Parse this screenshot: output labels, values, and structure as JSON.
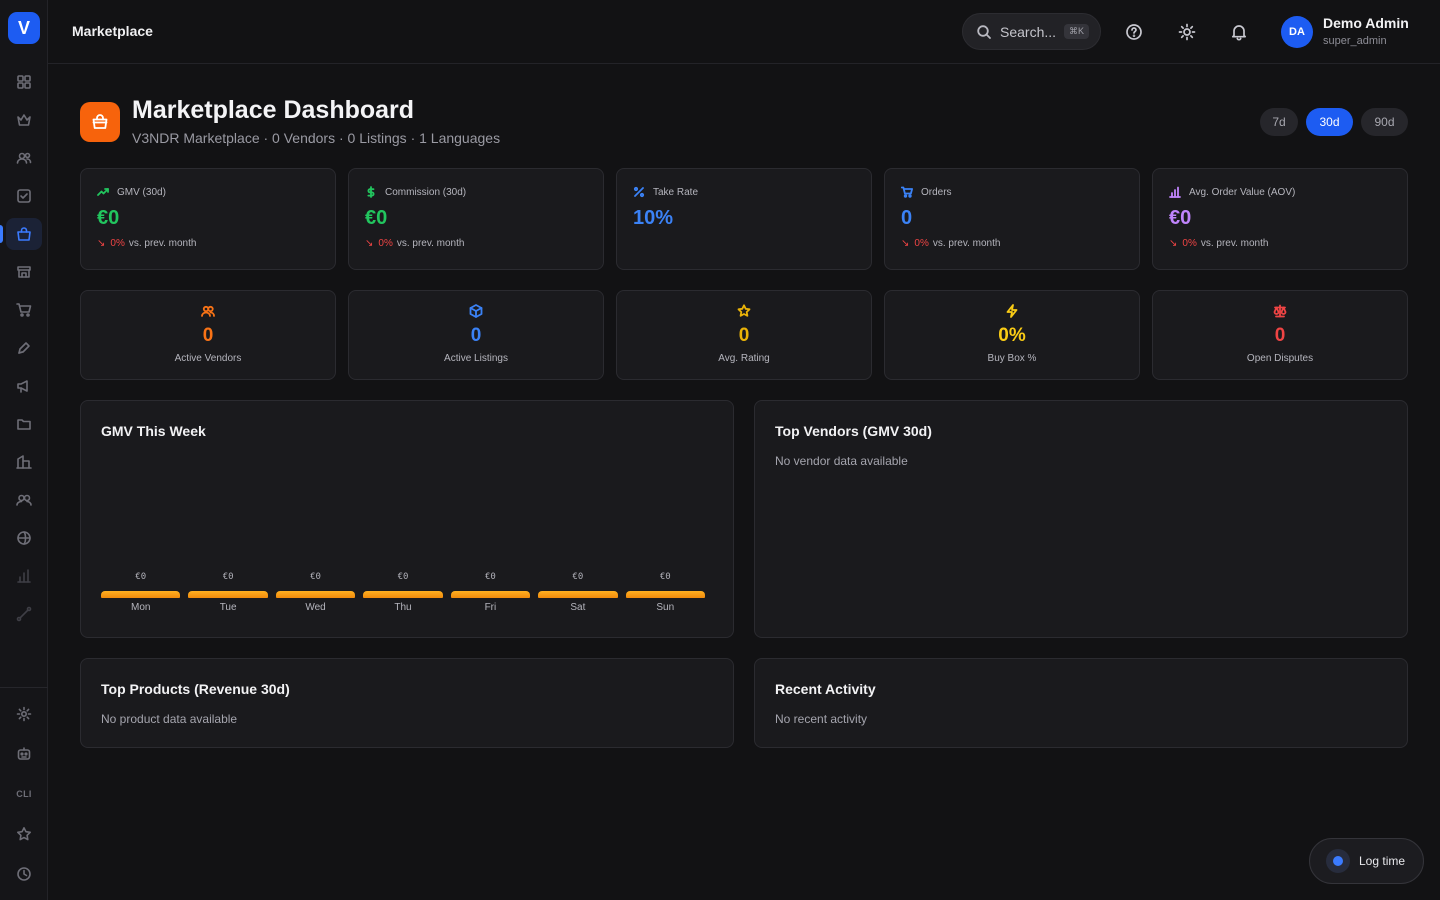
{
  "app": {
    "logo_letter": "V"
  },
  "topbar": {
    "title": "Marketplace",
    "search_placeholder": "Search...",
    "search_shortcut": "⌘K",
    "user": {
      "initials": "DA",
      "name": "Demo Admin",
      "role": "super_admin"
    }
  },
  "sidebar": {
    "items": [
      {
        "icon": "grid-icon"
      },
      {
        "icon": "crown-icon"
      },
      {
        "icon": "users-icon"
      },
      {
        "icon": "check-square-icon"
      },
      {
        "icon": "shopping-bag-icon",
        "active": true
      },
      {
        "icon": "store-icon"
      },
      {
        "icon": "cart-icon"
      },
      {
        "icon": "pen-icon"
      },
      {
        "icon": "megaphone-icon"
      },
      {
        "icon": "folder-icon"
      },
      {
        "icon": "building-icon"
      },
      {
        "icon": "team-icon"
      },
      {
        "icon": "globe-icon"
      },
      {
        "icon": "bar-chart-icon"
      },
      {
        "icon": "route-icon"
      }
    ],
    "bottom": {
      "cli_label": "CLI"
    }
  },
  "header": {
    "title": "Marketplace Dashboard",
    "subtitle": "V3NDR Marketplace · 0 Vendors · 0 Listings · 1 Languages",
    "ranges": [
      "7d",
      "30d",
      "90d"
    ],
    "active_range": "30d"
  },
  "kpis": [
    {
      "label": "GMV (30d)",
      "value": "€0",
      "delta": "0%",
      "delta_text": "vs. prev. month",
      "color": "#22c55e",
      "icon": "trending-up-icon"
    },
    {
      "label": "Commission (30d)",
      "value": "€0",
      "delta": "0%",
      "delta_text": "vs. prev. month",
      "color": "#22c55e",
      "icon": "dollar-icon"
    },
    {
      "label": "Take Rate",
      "value": "10%",
      "color": "#3b82f6",
      "icon": "percent-icon"
    },
    {
      "label": "Orders",
      "value": "0",
      "delta": "0%",
      "delta_text": "vs. prev. month",
      "color": "#3b82f6",
      "icon": "cart-icon"
    },
    {
      "label": "Avg. Order Value (AOV)",
      "value": "€0",
      "delta": "0%",
      "delta_text": "vs. prev. month",
      "color": "#c084fc",
      "icon": "bar-chart-icon"
    }
  ],
  "stats": [
    {
      "label": "Active Vendors",
      "value": "0",
      "color": "#f97316",
      "icon": "users-icon"
    },
    {
      "label": "Active Listings",
      "value": "0",
      "color": "#3b82f6",
      "icon": "package-icon"
    },
    {
      "label": "Avg. Rating",
      "value": "0",
      "color": "#eab308",
      "icon": "star-icon"
    },
    {
      "label": "Buy Box %",
      "value": "0%",
      "color": "#facc15",
      "icon": "lightning-icon"
    },
    {
      "label": "Open Disputes",
      "value": "0",
      "color": "#ef4444",
      "icon": "scale-icon"
    }
  ],
  "panels": {
    "gmv_week": {
      "title": "GMV This Week"
    },
    "top_vendors": {
      "title": "Top Vendors (GMV 30d)",
      "empty": "No vendor data available"
    },
    "top_products": {
      "title": "Top Products (Revenue 30d)",
      "empty": "No product data available"
    },
    "recent_activity": {
      "title": "Recent Activity",
      "empty": "No recent activity"
    }
  },
  "chart_data": {
    "type": "bar",
    "categories": [
      "Mon",
      "Tue",
      "Wed",
      "Thu",
      "Fri",
      "Sat",
      "Sun"
    ],
    "values": [
      0,
      0,
      0,
      0,
      0,
      0,
      0
    ],
    "value_labels": [
      "€0",
      "€0",
      "€0",
      "€0",
      "€0",
      "€0",
      "€0"
    ],
    "title": "GMV This Week",
    "color": "#f59e0b"
  },
  "log_time": {
    "label": "Log time"
  }
}
